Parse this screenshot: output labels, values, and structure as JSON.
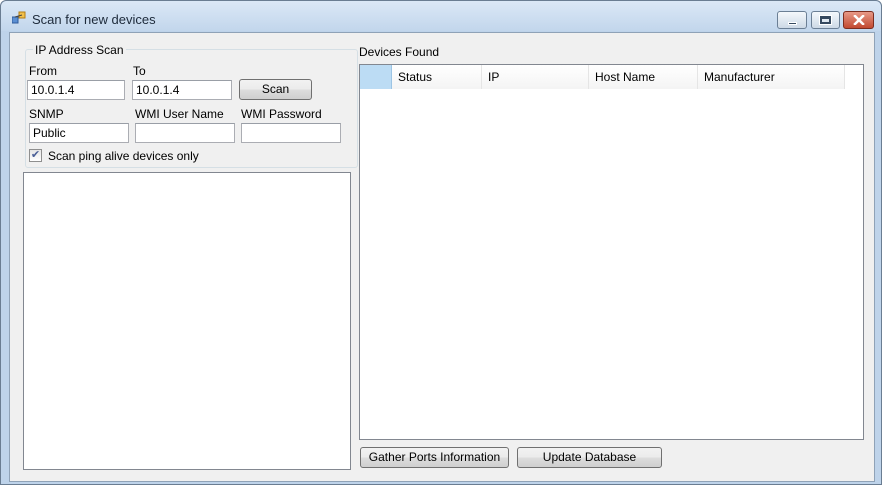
{
  "window": {
    "title": "Scan for new devices"
  },
  "ip_scan": {
    "group_label": "IP Address Scan",
    "from_label": "From",
    "from_value": "10.0.1.4",
    "to_label": "To",
    "to_value": "10.0.1.4",
    "scan_button": "Scan",
    "snmp_label": "SNMP",
    "snmp_value": "Public",
    "wmi_user_label": "WMI User Name",
    "wmi_user_value": "",
    "wmi_password_label": "WMI Password",
    "wmi_password_value": "",
    "ping_only_label": "Scan ping alive devices only",
    "ping_only_checked": true
  },
  "devices": {
    "label": "Devices Found",
    "columns": [
      "Status",
      "IP",
      "Host Name",
      "Manufacturer"
    ],
    "rows": []
  },
  "buttons": {
    "gather_ports": "Gather Ports Information",
    "update_db": "Update Database"
  },
  "colors": {
    "selected_header": "#bcdcf4",
    "close_button": "#c24a31"
  }
}
